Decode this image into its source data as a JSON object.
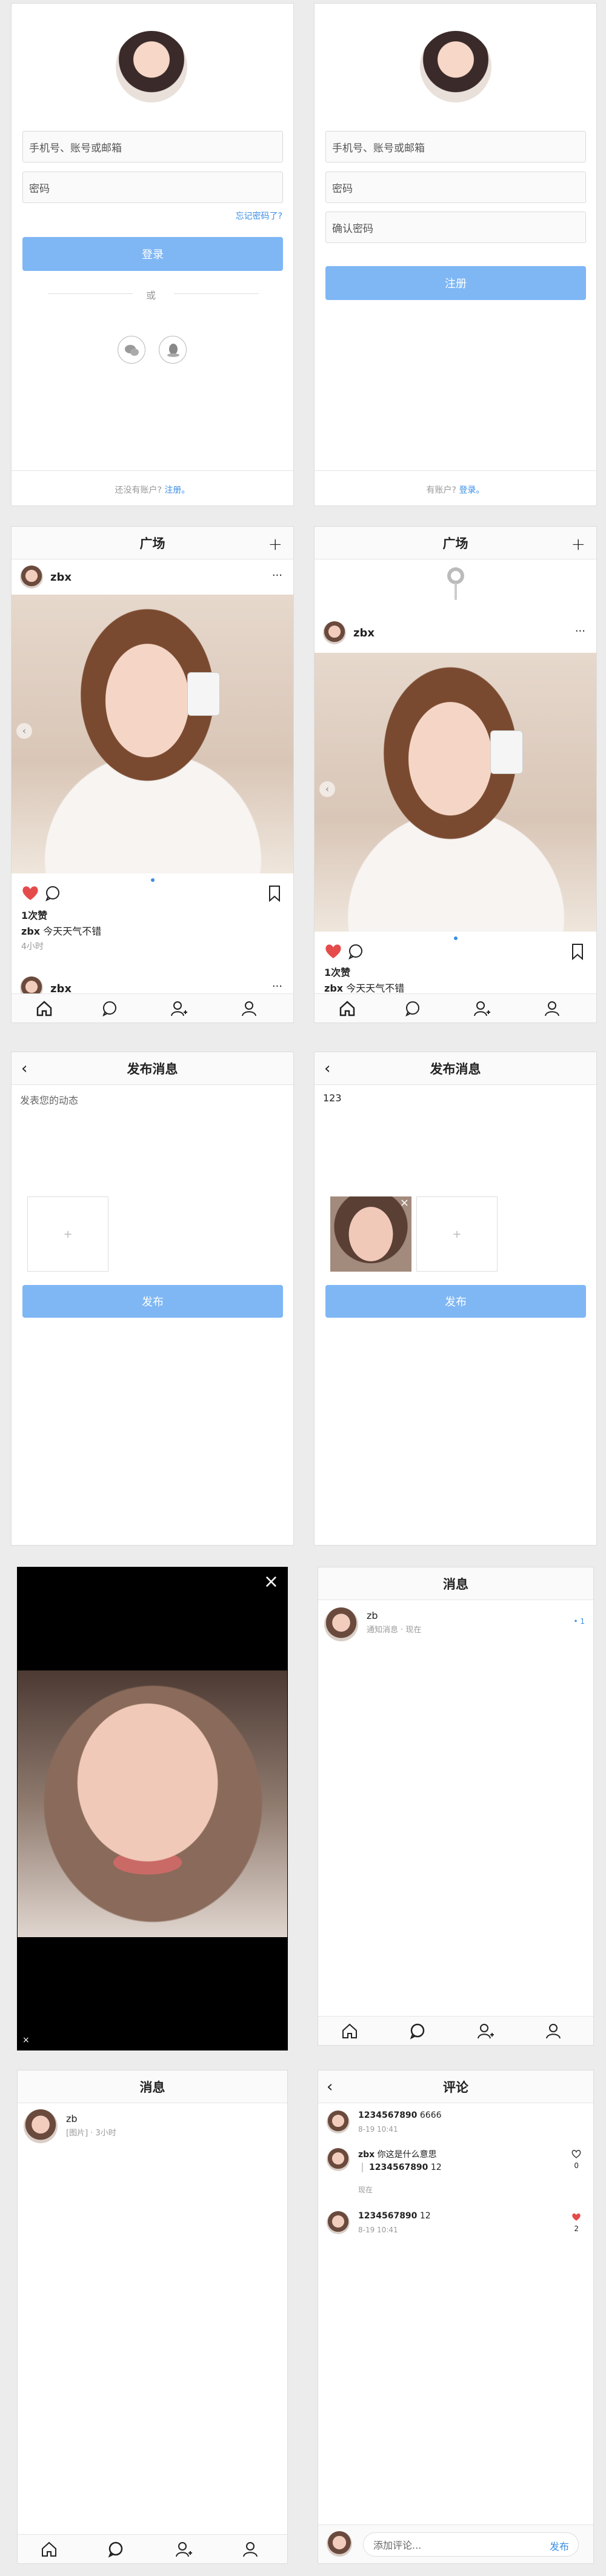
{
  "login": {
    "phone_placeholder": "手机号、账号或邮箱",
    "password_placeholder": "密码",
    "forgot": "忘记密码了?",
    "login_button": "登录",
    "or": "或",
    "no_account": "还没有账户?",
    "register_link": "注册。"
  },
  "register": {
    "phone_placeholder": "手机号、账号或邮箱",
    "password_placeholder": "密码",
    "confirm_placeholder": "确认密码",
    "register_button": "注册",
    "have_account": "有账户?",
    "login_link": "登录。"
  },
  "feed": {
    "title": "广场",
    "add_icon": "plus-icon",
    "user": "zbx",
    "more": "···",
    "likes": "1次赞",
    "caption_user": "zbx",
    "caption_text": "今天天气不错",
    "time": "4小时",
    "next_user": "zbx"
  },
  "feed_refresh": {
    "title": "广场",
    "user": "zbx",
    "more": "···",
    "likes": "1次赞",
    "caption_user": "zbx",
    "caption_text": "今天天气不错"
  },
  "publish_empty": {
    "title": "发布消息",
    "placeholder": "发表您的动态",
    "add_symbol": "+",
    "publish_button": "发布"
  },
  "publish_filled": {
    "title": "发布消息",
    "text": "123",
    "add_symbol": "+",
    "remove_symbol": "×",
    "publish_button": "发布"
  },
  "viewer": {
    "close": "×",
    "small_close": "×"
  },
  "messages": {
    "title": "消息",
    "name": "zb",
    "preview": "通知消息 · 现在",
    "badge": "• 1"
  },
  "messages2": {
    "title": "消息",
    "name": "zb",
    "preview": "[图片] · 3小时"
  },
  "comments": {
    "title": "评论",
    "items": [
      {
        "user": "1234567890",
        "text": "6666",
        "time": "8-19 10:41"
      },
      {
        "user": "zbx",
        "text": "你这是什么意思",
        "reply_user": "1234567890",
        "reply_text": "12",
        "time": "现在",
        "likes": "0"
      },
      {
        "user": "1234567890",
        "text": "12",
        "time": "8-19 10:41",
        "likes": "2"
      }
    ],
    "input_placeholder": "添加评论...",
    "send": "发布"
  }
}
